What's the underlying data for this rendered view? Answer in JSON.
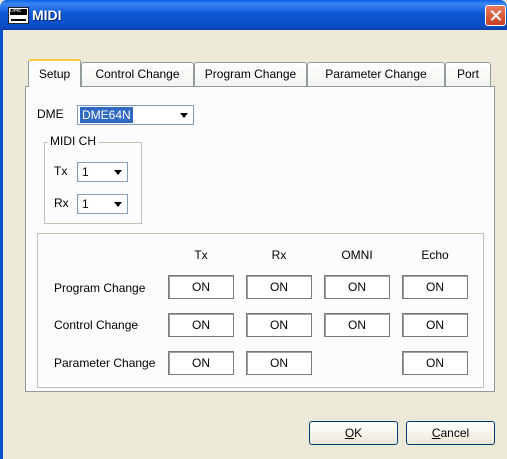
{
  "window": {
    "title": "MIDI",
    "icon_text": "DME"
  },
  "tabs": [
    {
      "label": "Setup",
      "active": true
    },
    {
      "label": "Control Change",
      "active": false
    },
    {
      "label": "Program Change",
      "active": false
    },
    {
      "label": "Parameter Change",
      "active": false
    },
    {
      "label": "Port",
      "active": false
    }
  ],
  "setup": {
    "dme_label": "DME",
    "dme_value": "DME64N",
    "midi_ch_group": "MIDI CH",
    "tx_label": "Tx",
    "tx_value": "1",
    "rx_label": "Rx",
    "rx_value": "1"
  },
  "matrix": {
    "columns": [
      "Tx",
      "Rx",
      "OMNI",
      "Echo"
    ],
    "rows": [
      {
        "label": "Program Change",
        "tx": "ON",
        "rx": "ON",
        "omni": "ON",
        "echo": "ON"
      },
      {
        "label": "Control Change",
        "tx": "ON",
        "rx": "ON",
        "omni": "ON",
        "echo": "ON"
      },
      {
        "label": "Parameter Change",
        "tx": "ON",
        "rx": "ON",
        "omni": null,
        "echo": "ON"
      }
    ]
  },
  "buttons": {
    "ok_mnemonic": "O",
    "ok_rest": "K",
    "cancel_mnemonic": "C",
    "cancel_rest": "ancel"
  }
}
